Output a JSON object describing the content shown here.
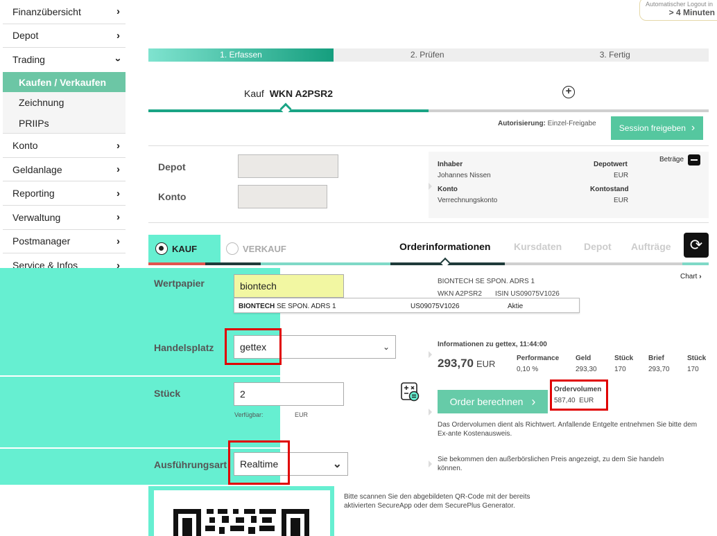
{
  "sidebar": {
    "items": [
      {
        "label": "Finanzübersicht"
      },
      {
        "label": "Depot"
      },
      {
        "label": "Trading"
      },
      {
        "label": "Konto"
      },
      {
        "label": "Geldanlage"
      },
      {
        "label": "Reporting"
      },
      {
        "label": "Verwaltung"
      },
      {
        "label": "Postmanager"
      },
      {
        "label": "Service & Infos"
      }
    ],
    "trading_sub": [
      {
        "label": "Kaufen / Verkaufen"
      },
      {
        "label": "Zeichnung"
      },
      {
        "label": "PRIIPs"
      }
    ]
  },
  "logout": {
    "line1": "Automatischer Logout in",
    "line2": "> 4 Minuten"
  },
  "steps": [
    "1. Erfassen",
    "2. Prüfen",
    "3. Fertig"
  ],
  "order_tab": {
    "prefix": "Kauf",
    "wkn": "WKN A2PSR2",
    "plus": "+"
  },
  "auth": {
    "label": "Autorisierung:",
    "value": "Einzel-Freigabe"
  },
  "session_button": "Session freigeben",
  "depot_panel": {
    "depot_label": "Depot",
    "konto_label": "Konto",
    "inhaber_label": "Inhaber",
    "inhaber_value": "Johannes Nissen",
    "depotwert_label": "Depotwert",
    "depotwert_currency": "EUR",
    "konto_info_label": "Konto",
    "konto_info_value": "Verrechnungskonto",
    "kontostand_label": "Kontostand",
    "kontostand_currency": "EUR",
    "betraege": "Beträge"
  },
  "trade_type": {
    "kauf": "KAUF",
    "verkauf": "VERKAUF"
  },
  "info_tabs": [
    "Orderinformationen",
    "Kursdaten",
    "Depot",
    "Aufträge"
  ],
  "form": {
    "wertpapier_label": "Wertpapier",
    "wertpapier_value": "biontech",
    "handelsplatz_label": "Handelsplatz",
    "handelsplatz_value": "gettex",
    "stueck_label": "Stück",
    "stueck_value": "2",
    "verfuegbar_label": "Verfügbar:",
    "verfuegbar_currency": "EUR",
    "ausfuehrung_label": "Ausführungsart",
    "ausfuehrung_value": "Realtime"
  },
  "suggestion": {
    "name_bold": "BIONTECH",
    "name_rest": " SE SPON. ADRS 1",
    "isin": "US09075V1026",
    "type": "Aktie"
  },
  "security_info": {
    "name": "BIONTECH SE SPON. ADRS 1",
    "wkn": "WKN A2PSR2",
    "isin": "ISIN US09075V1026",
    "chart_link": "Chart"
  },
  "quote": {
    "header": "Informationen zu gettex, 11:44:00",
    "price": "293,70",
    "currency": "EUR",
    "performance_label": "Performance",
    "performance_value": "0,10 %",
    "geld_label": "Geld",
    "geld_value": "293,30",
    "stueck1_label": "Stück",
    "stueck1_value": "170",
    "brief_label": "Brief",
    "brief_value": "293,70",
    "stueck2_label": "Stück",
    "stueck2_value": "170"
  },
  "order_button": "Order berechnen",
  "ordervolumen": {
    "label": "Ordervolumen",
    "value": "587,40",
    "currency": "EUR"
  },
  "notes": {
    "ordervolumen_note": "Das Ordervolumen dient als Richtwert. Anfallende Entgelte entnehmen Sie bitte dem Ex-ante Kostenausweis.",
    "realtime_note": "Sie bekommen den außerbörslichen Preis angezeigt, zu dem Sie handeln können.",
    "qr_note": "Bitte scannen Sie den abgebildeten QR-Code mit der bereits aktivierten SecureApp oder dem SecurePlus Generator."
  }
}
